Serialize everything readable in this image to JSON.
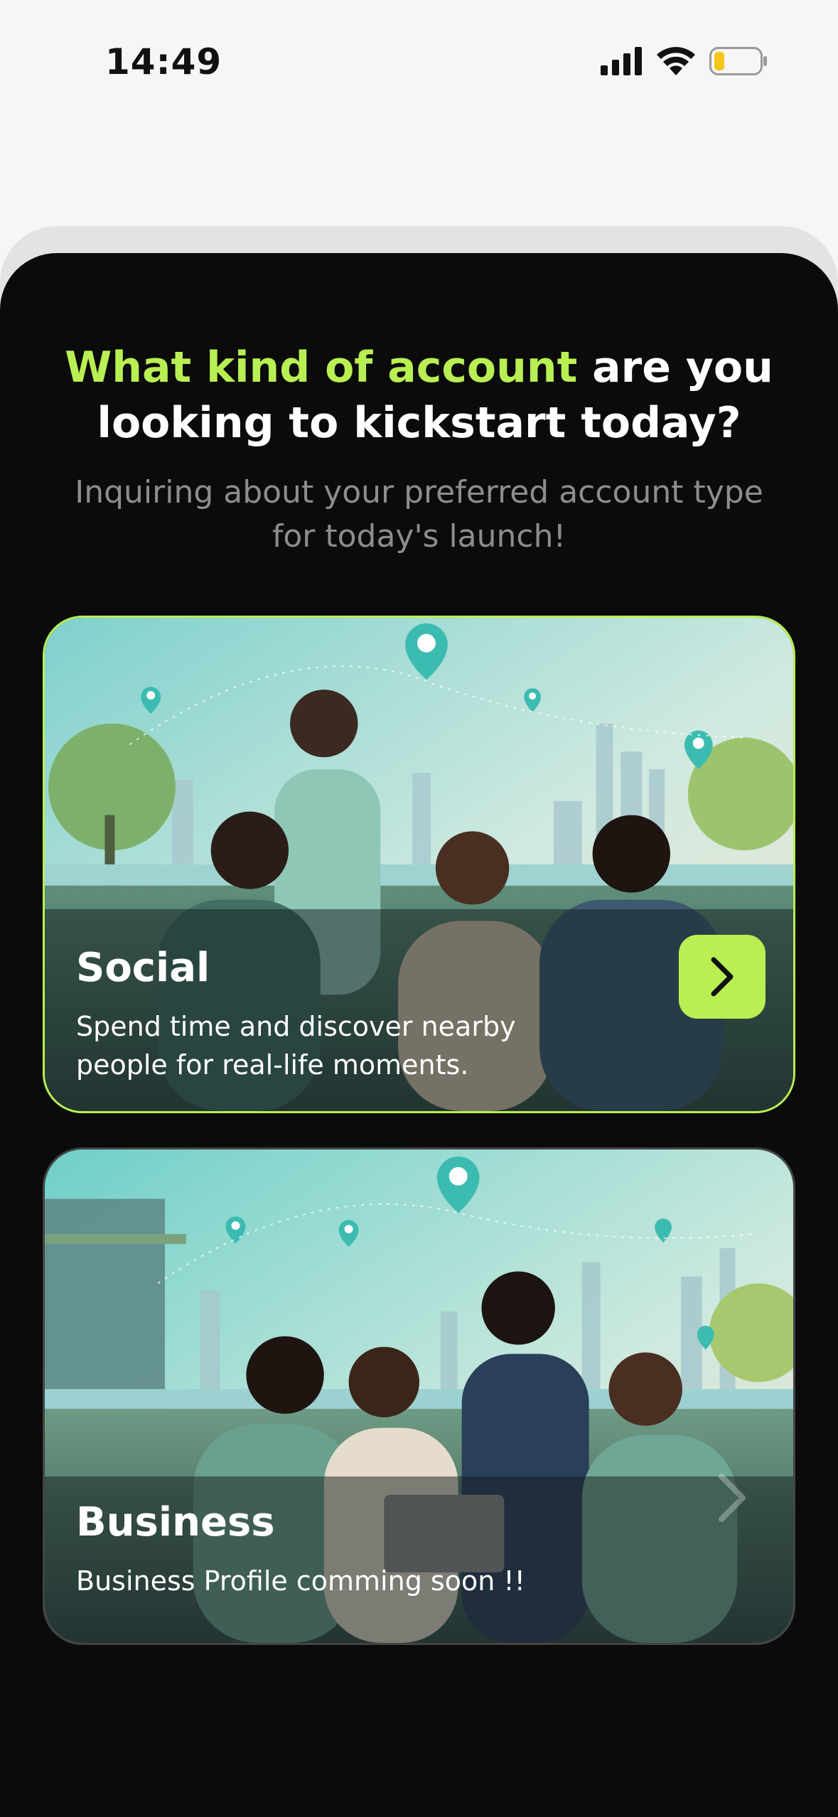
{
  "status_bar": {
    "time": "14:49",
    "icons": [
      "signal-icon",
      "wifi-icon",
      "battery-icon"
    ],
    "battery_color": "#f5c518"
  },
  "header": {
    "title_accent": "What kind of account",
    "title_rest": "are you looking to kickstart today?",
    "subtitle": "Inquiring about your preferred account type for today's launch!"
  },
  "colors": {
    "accent": "#b8ef52",
    "sheet_background": "#0b0b0b",
    "page_background": "#f6f6f6"
  },
  "cards": [
    {
      "title": "Social",
      "description": "Spend time and discover nearby people for real-life moments.",
      "illustration": "friends-at-cafe-illustration",
      "action_icon": "chevron-right-icon",
      "selected": true
    },
    {
      "title": "Business",
      "description": "Business Profile comming soon !!",
      "illustration": "business-meeting-illustration",
      "action_icon": "chevron-right-icon",
      "selected": false
    }
  ]
}
